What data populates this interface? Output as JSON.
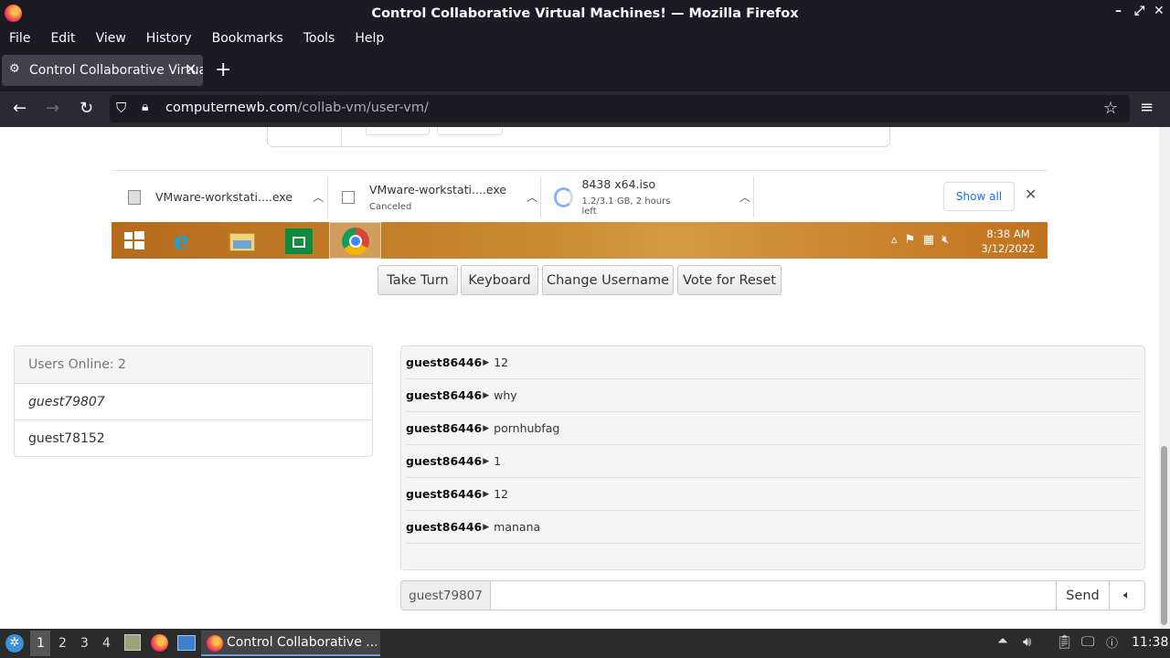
{
  "window": {
    "title": "Control Collaborative Virtual Machines! — Mozilla Firefox"
  },
  "menu": [
    "File",
    "Edit",
    "View",
    "History",
    "Bookmarks",
    "Tools",
    "Help"
  ],
  "tab": {
    "title": "Control Collaborative Virtual Machines!"
  },
  "nav": {
    "url_host": "computernewb.com",
    "url_path": "/collab-vm/user-vm/"
  },
  "vm": {
    "downloads": [
      {
        "name": "VMware-workstati....exe",
        "status": ""
      },
      {
        "name": "VMware-workstati....exe",
        "status": "Canceled"
      },
      {
        "name": "8438 x64.iso",
        "status": "1.2/3.1 GB, 2 hours left"
      }
    ],
    "show_all": "Show all",
    "clock_time": "8:38 AM",
    "clock_date": "3/12/2022"
  },
  "controls": [
    "Take Turn",
    "Keyboard",
    "Change Username",
    "Vote for Reset"
  ],
  "users": {
    "header": "Users Online: 2",
    "list": [
      "guest79807",
      "guest78152"
    ]
  },
  "chat": {
    "messages": [
      {
        "user": "guest86446",
        "text": "12"
      },
      {
        "user": "guest86446",
        "text": "why"
      },
      {
        "user": "guest86446",
        "text": "pornhubfag"
      },
      {
        "user": "guest86446",
        "text": "1"
      },
      {
        "user": "guest86446",
        "text": "12"
      },
      {
        "user": "guest86446",
        "text": "manana"
      }
    ],
    "username": "guest79807",
    "send": "Send"
  },
  "os": {
    "workspaces": [
      "1",
      "2",
      "3",
      "4"
    ],
    "task": "Control Collaborative ...",
    "clock": "11:38"
  }
}
